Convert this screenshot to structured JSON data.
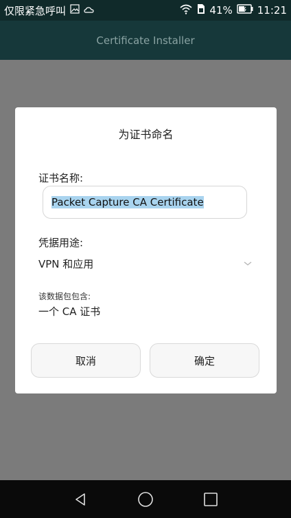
{
  "status_bar": {
    "left_text": "仅限紧急呼叫",
    "battery_percent": "41%",
    "time": "11:21"
  },
  "app_bar": {
    "title": "Certificate Installer"
  },
  "dialog": {
    "title": "为证书命名",
    "cert_name_label": "证书名称:",
    "cert_name_value": "Packet Capture CA Certificate",
    "usage_label": "凭据用途:",
    "usage_value": "VPN 和应用",
    "contains_label": "该数据包包含:",
    "contains_value": "一个 CA 证书",
    "cancel_label": "取消",
    "ok_label": "确定"
  },
  "icons": {
    "status": [
      "image-icon",
      "cloud-icon",
      "wifi-icon",
      "sim-icon",
      "battery-icon"
    ],
    "nav": [
      "back-icon",
      "home-icon",
      "recents-icon"
    ]
  }
}
